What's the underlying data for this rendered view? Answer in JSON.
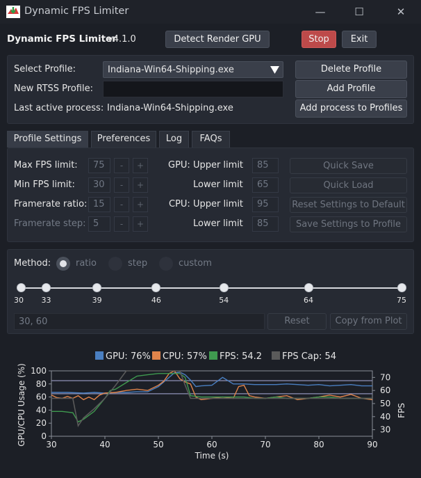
{
  "window": {
    "title": "Dynamic FPS Limiter",
    "minimize": "—",
    "maximize": "☐",
    "close": "✕"
  },
  "header": {
    "app_name": "Dynamic FPS Limiter",
    "version": "v4.1.0",
    "detect_button": "Detect Render GPU",
    "stop_button": "Stop",
    "exit_button": "Exit"
  },
  "profile": {
    "select_label": "Select Profile:",
    "selected": "Indiana-Win64-Shipping.exe",
    "new_rtss_label": "New RTSS Profile:",
    "new_rtss_value": "",
    "last_active_label": "Last active process:",
    "last_active_value": "Indiana-Win64-Shipping.exe",
    "delete_button": "Delete Profile",
    "add_button": "Add Profile",
    "add_process_button": "Add process to Profiles"
  },
  "tabs": [
    "Profile Settings",
    "Preferences",
    "Log",
    "FAQs"
  ],
  "settings": {
    "rows": [
      {
        "label": "Max FPS limit:",
        "value": "75",
        "dim": false
      },
      {
        "label": "Min FPS limit:",
        "value": "30",
        "dim": false
      },
      {
        "label": "Framerate ratio:",
        "value": "15",
        "dim": false
      },
      {
        "label": "Framerate step:",
        "value": "5",
        "dim": true
      }
    ],
    "minus": "-",
    "plus": "+",
    "limits": [
      {
        "label": "GPU: Upper limit",
        "value": "85"
      },
      {
        "label": "Lower limit",
        "value": "65"
      },
      {
        "label": "CPU: Upper limit",
        "value": "95"
      },
      {
        "label": "Lower limit",
        "value": "85"
      }
    ],
    "actions": [
      "Quick Save",
      "Quick Load",
      "Reset Settings to Default",
      "Save Settings to Profile"
    ]
  },
  "method": {
    "label": "Method:",
    "options": [
      "ratio",
      "step",
      "custom"
    ],
    "selected": "ratio",
    "slider_values": [
      30,
      33,
      39,
      46,
      54,
      64,
      75
    ],
    "custom_value": "30, 60",
    "reset_button": "Reset",
    "copy_button": "Copy from Plot"
  },
  "chart_data": {
    "type": "line",
    "legend": [
      {
        "label": "GPU: 76%",
        "color": "#4a7fc1"
      },
      {
        "label": "CPU: 57%",
        "color": "#e0844b"
      },
      {
        "label": "FPS: 54.2",
        "color": "#3f9a4f"
      },
      {
        "label": "FPS Cap: 54",
        "color": "#5a5a5a"
      }
    ],
    "xlabel": "Time (s)",
    "ylabel_left": "GPU/CPU Usage (%)",
    "ylabel_right": "FPS",
    "xlim": [
      30,
      90
    ],
    "ylim_left": [
      0,
      100
    ],
    "ylim_right": [
      25,
      75
    ],
    "x_ticks": [
      30,
      40,
      50,
      60,
      70,
      80,
      90
    ],
    "y_ticks_left": [
      0,
      20,
      40,
      60,
      80,
      100
    ],
    "y_ticks_right": [
      30,
      40,
      50,
      60,
      70
    ],
    "threshold_lines_left": [
      85,
      65
    ],
    "series": [
      {
        "name": "GPU",
        "color": "#4a7fc1",
        "axis": "left",
        "x": [
          30,
          33,
          36,
          38,
          40,
          42,
          44,
          46,
          48,
          50,
          52,
          53,
          54,
          55,
          56,
          57,
          58,
          60,
          62,
          64,
          66,
          68,
          70,
          72,
          74,
          76,
          78,
          80,
          82,
          84,
          86,
          88,
          90
        ],
        "y": [
          67,
          67,
          66,
          67,
          66,
          67,
          67,
          68,
          68,
          76,
          90,
          97,
          98,
          94,
          86,
          76,
          77,
          78,
          90,
          80,
          80,
          79,
          79,
          79,
          80,
          79,
          78,
          79,
          77,
          78,
          79,
          77,
          77
        ]
      },
      {
        "name": "CPU",
        "color": "#e0844b",
        "axis": "left",
        "x": [
          30,
          31,
          32,
          33,
          34,
          35,
          36,
          37,
          38,
          39,
          40,
          42,
          44,
          46,
          48,
          50,
          51,
          52,
          53,
          54,
          55,
          56,
          57,
          58,
          60,
          62,
          64,
          65,
          66,
          67,
          68,
          70,
          72,
          74,
          76,
          78,
          80,
          82,
          84,
          86,
          88,
          90
        ],
        "y": [
          63,
          59,
          58,
          61,
          58,
          62,
          56,
          60,
          56,
          63,
          66,
          67,
          70,
          72,
          70,
          78,
          84,
          96,
          100,
          88,
          83,
          80,
          60,
          56,
          58,
          60,
          58,
          76,
          78,
          62,
          60,
          58,
          60,
          62,
          56,
          58,
          60,
          63,
          60,
          64,
          58,
          56
        ]
      },
      {
        "name": "FPS",
        "color": "#3f9a4f",
        "axis": "right",
        "x": [
          30,
          32,
          34,
          35,
          36,
          38,
          40,
          41,
          42,
          44,
          46,
          48,
          50,
          52,
          54,
          55,
          56,
          58,
          60,
          62,
          64,
          66,
          68,
          70,
          72,
          74,
          76,
          78,
          80,
          82,
          84,
          86,
          88,
          90
        ],
        "y": [
          44,
          44,
          43,
          36,
          38,
          44,
          54,
          60,
          61,
          66,
          71,
          72,
          73,
          73,
          73,
          70,
          56,
          55,
          55,
          55,
          55,
          55,
          54,
          54,
          55,
          54,
          54,
          54,
          55,
          55,
          54,
          54,
          54,
          54
        ]
      },
      {
        "name": "FPS Cap",
        "color": "#5a5a5a",
        "axis": "right",
        "x": [
          30,
          32,
          34,
          35,
          36,
          38,
          40,
          42,
          44,
          46,
          48,
          50,
          52,
          54,
          55,
          56,
          58,
          60,
          62,
          64,
          66,
          68,
          70,
          72,
          74,
          76,
          78,
          80,
          82,
          84,
          86,
          88,
          90
        ],
        "y": [
          54,
          54,
          54,
          33,
          39,
          46,
          54,
          64,
          75,
          75,
          75,
          75,
          75,
          75,
          64,
          54,
          54,
          54,
          54,
          54,
          54,
          54,
          54,
          54,
          54,
          54,
          54,
          54,
          54,
          54,
          54,
          54,
          54
        ]
      }
    ]
  }
}
